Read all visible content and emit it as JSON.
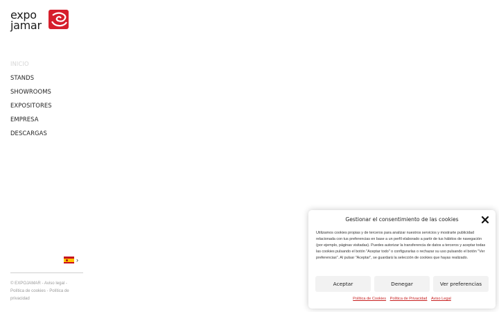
{
  "logo": {
    "line1": "expo",
    "line2": "jamar",
    "brand_color": "#d61f2c"
  },
  "nav": {
    "items": [
      {
        "label": "INICIO",
        "active": true
      },
      {
        "label": "STANDS",
        "active": false
      },
      {
        "label": "SHOWROOMS",
        "active": false
      },
      {
        "label": "EXPOSITORES",
        "active": false
      },
      {
        "label": "EMPRESA",
        "active": false
      },
      {
        "label": "DESCARGAS",
        "active": false
      }
    ]
  },
  "language": {
    "flag": "spain-flag-icon",
    "chevron": "›"
  },
  "footer": {
    "copyright": "© EXPOJAMAR",
    "sep1": " - ",
    "legal": "Aviso legal",
    "sep2": " - ",
    "cookies": "Política de cookies",
    "sep3": " - ",
    "privacy": "Política de privacidad"
  },
  "cookie_banner": {
    "title": "Gestionar el consentimiento de las cookies",
    "body": "Utilizamos cookies propias y de terceros para analizar nuestros servicios y mostrarte publicidad relacionada con tus preferencias en base a un perfil elaborado a partir de tus hábitos de navegación (por ejemplo, páginas visitadas). Puedes autorizar la transferencia de datos a terceros y aceptar todas las cookies pulsando el botón \"Aceptar todo\" o configurarlas o rechazar su uso pulsando el botón \"Ver preferencias\". Al pulsar \"Aceptar\", se guardará la selección de cookies que hayas realizado.",
    "accept_label": "Aceptar",
    "deny_label": "Denegar",
    "prefs_label": "Ver preferencias",
    "links": {
      "cookies": "Política de Cookies",
      "privacy": "Política de Privacidad",
      "legal": "Aviso Legal"
    },
    "accent_color": "#c81f1f"
  }
}
